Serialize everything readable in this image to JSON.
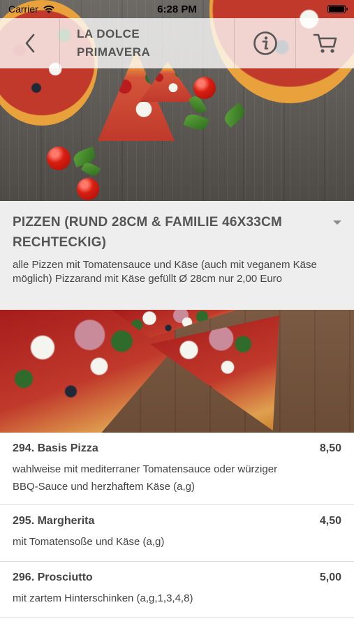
{
  "status_bar": {
    "carrier": "Carrier",
    "time": "6:28 PM"
  },
  "navbar": {
    "title_line1": "LA DOLCE",
    "title_line2": "PRIMAVERA",
    "back_icon": "chevron-left-icon",
    "info_icon": "info-icon",
    "cart_icon": "cart-icon"
  },
  "category": {
    "title": "PIZZEN (RUND 28CM & FAMILIE 46X33CM RECHTECKIG)",
    "description": "alle Pizzen mit Tomatensauce und Käse (auch mit veganem Käse möglich) Pizzarand mit Käse gefüllt Ø 28cm nur 2,00 Euro"
  },
  "items": [
    {
      "name": "294. Basis Pizza",
      "price": "8,50",
      "description": "wahlweise mit mediterraner Tomatensauce oder würziger BBQ-Sauce und herzhaftem Käse (a,g)"
    },
    {
      "name": "295. Margherita",
      "price": "4,50",
      "description": "mit Tomatensoße und Käse (a,g)"
    },
    {
      "name": "296. Prosciutto",
      "price": "5,00",
      "description": "mit zartem Hinterschinken (a,g,1,3,4,8)"
    }
  ]
}
